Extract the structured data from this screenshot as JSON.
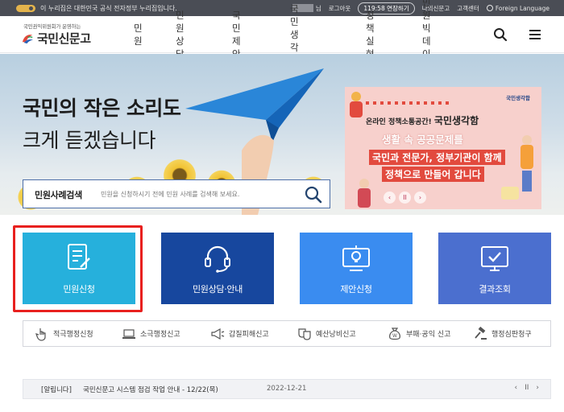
{
  "govbar": {
    "notice": "이 누리집은 대한민국 공식 전자정부 누리집입니다.",
    "user_suffix": "님",
    "logout": "로그아웃",
    "session": "119:58 연장하기",
    "my_page": "나의신문고",
    "support": "고객센터",
    "language": "Foreign Language"
  },
  "header": {
    "logo_tagline": "국민권익위원회가 운영하는",
    "logo_name": "국민신문고",
    "nav": [
      "민원",
      "민원상담",
      "국민제안",
      "국민생각함",
      "정책실현",
      "민원빅데이터"
    ]
  },
  "hero": {
    "title_line1": "국민의 작은 소리도",
    "title_line2": "크게 듣겠습니다"
  },
  "search": {
    "label": "민원사례검색",
    "placeholder": "민원을 신청하시기 전에 민원 사례를 검색해 보세요."
  },
  "promo": {
    "brand": "국민생각함",
    "subtitle_prefix": "온라인 정책소통공간!",
    "subtitle_name": "국민생각함",
    "line1": "생활 속 공공문제를",
    "line2": "국민과 전문가, 정부기관이 함께",
    "line3": "정책으로 만들어 갑니다",
    "prev": "‹",
    "pause": "II",
    "next": "›"
  },
  "tiles": [
    {
      "label": "민원신청",
      "color": "#26b0dc"
    },
    {
      "label": "민원상담·안내",
      "color": "#17479e"
    },
    {
      "label": "제안신청",
      "color": "#3a8cf0"
    },
    {
      "label": "결과조회",
      "color": "#4b6fcf"
    }
  ],
  "quick_links": [
    "적극행정신청",
    "소극행정신고",
    "갑질피해신고",
    "예산낭비신고",
    "부패·공익 신고",
    "행정심판청구"
  ],
  "notice": {
    "tag": "[알립니다]",
    "text": "국민신문고 시스템 점검 작업 안내 - 12/22(목)",
    "date": "2022-12-21",
    "prev": "‹",
    "pause": "II",
    "next": "›"
  },
  "colors": {
    "highlight": "#e8201e",
    "accent": "#e24a3e"
  }
}
